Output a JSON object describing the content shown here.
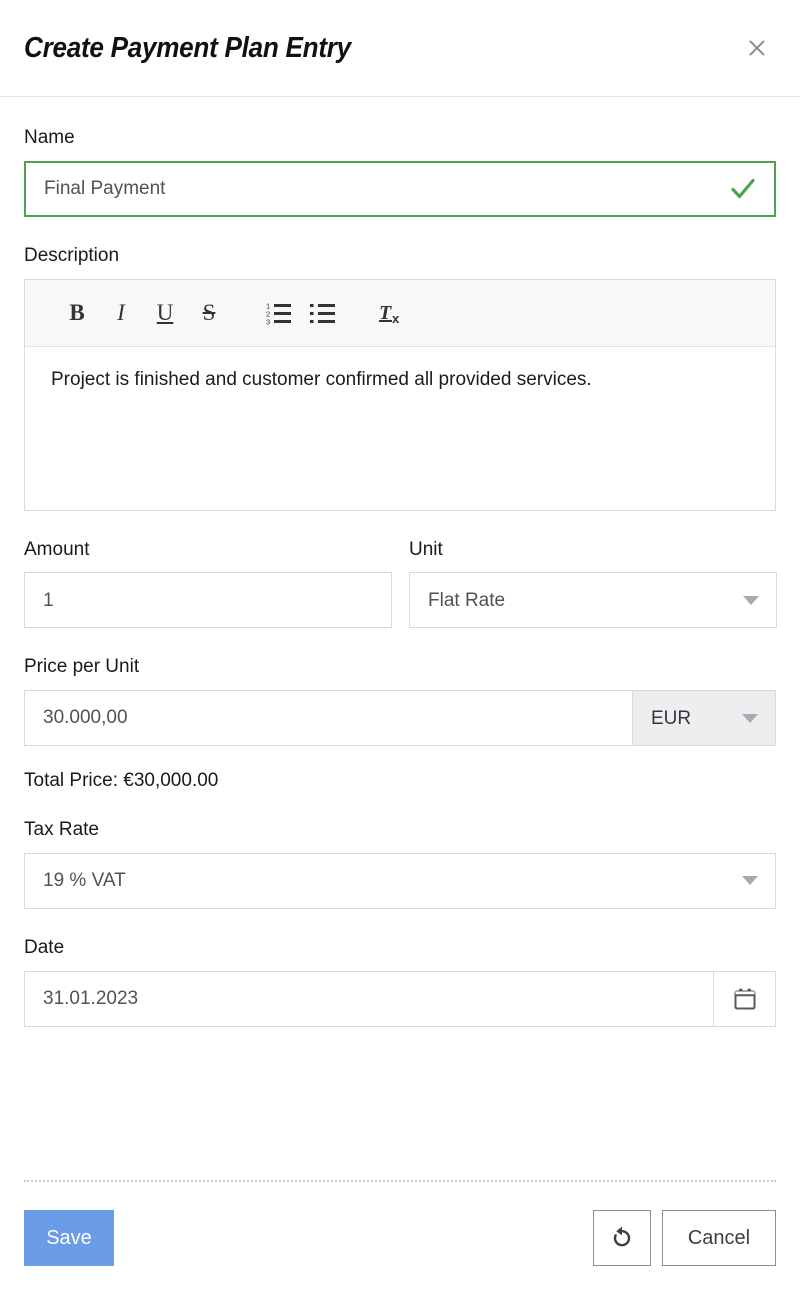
{
  "header": {
    "title": "Create Payment Plan Entry",
    "close_icon": "close-icon"
  },
  "form": {
    "name": {
      "label": "Name",
      "value": "Final Payment",
      "placeholder": "Name",
      "valid": true,
      "valid_icon": "check-icon"
    },
    "description": {
      "label": "Description",
      "content": "Project is finished and customer confirmed all provided services.",
      "toolbar": [
        {
          "name": "bold-icon",
          "glyph": "B",
          "title": "Bold"
        },
        {
          "name": "italic-icon",
          "glyph": "I",
          "title": "Italic"
        },
        {
          "name": "underline-icon",
          "glyph": "U",
          "title": "Underline"
        },
        {
          "name": "strikethrough-icon",
          "glyph": "S",
          "title": "Strikethrough"
        },
        {
          "name": "ordered-list-icon",
          "glyph": "",
          "title": "Numbered List"
        },
        {
          "name": "unordered-list-icon",
          "glyph": "",
          "title": "Bulleted List"
        },
        {
          "name": "clear-format-icon",
          "glyph": "",
          "title": "Remove Format"
        }
      ]
    },
    "amount": {
      "label": "Amount",
      "value": "1",
      "placeholder": "Amount"
    },
    "unit": {
      "label": "Unit",
      "value": "Flat Rate",
      "caret_icon": "chevron-down-icon"
    },
    "price_per_unit": {
      "label": "Price per Unit",
      "value": "30.000,00",
      "placeholder": "Price per Unit",
      "currency": "EUR",
      "currency_caret_icon": "chevron-down-icon"
    },
    "total_price": "Total Price: €30,000.00",
    "tax_rate": {
      "label": "Tax Rate",
      "value": "19 % VAT",
      "caret_icon": "chevron-down-icon"
    },
    "date": {
      "label": "Date",
      "value": "31.01.2023",
      "placeholder": "Date",
      "calendar_icon": "calendar-icon"
    }
  },
  "footer": {
    "save_label": "Save",
    "reset_icon": "undo-icon",
    "cancel_label": "Cancel"
  },
  "colors": {
    "accent": "#6a9ce8",
    "valid": "#4ea24e",
    "border": "#d7dade",
    "muted_text": "#4f5358",
    "append_bg": "#eceef0"
  }
}
